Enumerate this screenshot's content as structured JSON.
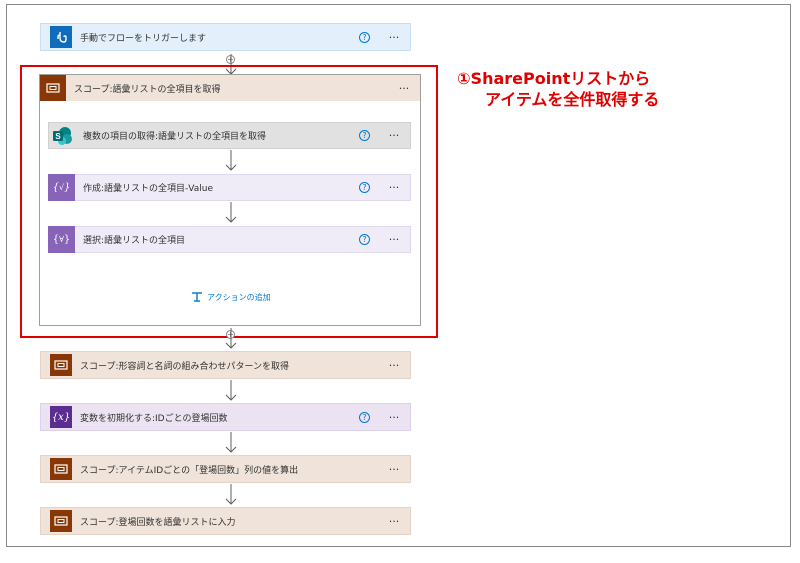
{
  "trigger": {
    "label": "手動でフローをトリガーします",
    "help": "?",
    "more": "···"
  },
  "scope1": {
    "label": "スコープ:語彙リストの全項目を取得",
    "more": "···"
  },
  "actions": [
    {
      "label": "複数の項目の取得:語彙リストの全項目を取得",
      "help": "?",
      "more": "···"
    },
    {
      "label": "作成:語彙リストの全項目-Value",
      "help": "?",
      "more": "···"
    },
    {
      "label": "選択:語彙リストの全項目",
      "help": "?",
      "more": "···"
    }
  ],
  "add_action": {
    "label": "アクションの追加"
  },
  "steps": [
    {
      "label": "スコープ:形容詞と名詞の組み合わせパターンを取得",
      "more": "···"
    },
    {
      "label": "変数を初期化する:IDごとの登場回数",
      "help": "?",
      "more": "···"
    },
    {
      "label": "スコープ:アイテムIDごとの「登場回数」列の値を算出",
      "more": "···"
    },
    {
      "label": "スコープ:登場回数を語彙リストに入力",
      "more": "···"
    }
  ],
  "callout": {
    "line1": "①SharePointリストから",
    "line2": "アイテムを全件取得する"
  },
  "icons": {
    "trigger": "hand-touch-icon",
    "scope": "scope-icon",
    "sharepoint": "sharepoint-icon",
    "compose": "compose-icon",
    "select": "select-icon",
    "variable": "variable-icon",
    "add": "add-action-icon"
  },
  "colors": {
    "trigger": "#0f6cbd",
    "scope": "#8a3707",
    "sharepoint": "#038387",
    "compose": "#8764b8",
    "variable": "#5c2d91",
    "callout": "#e00000",
    "link": "#0078d4"
  }
}
